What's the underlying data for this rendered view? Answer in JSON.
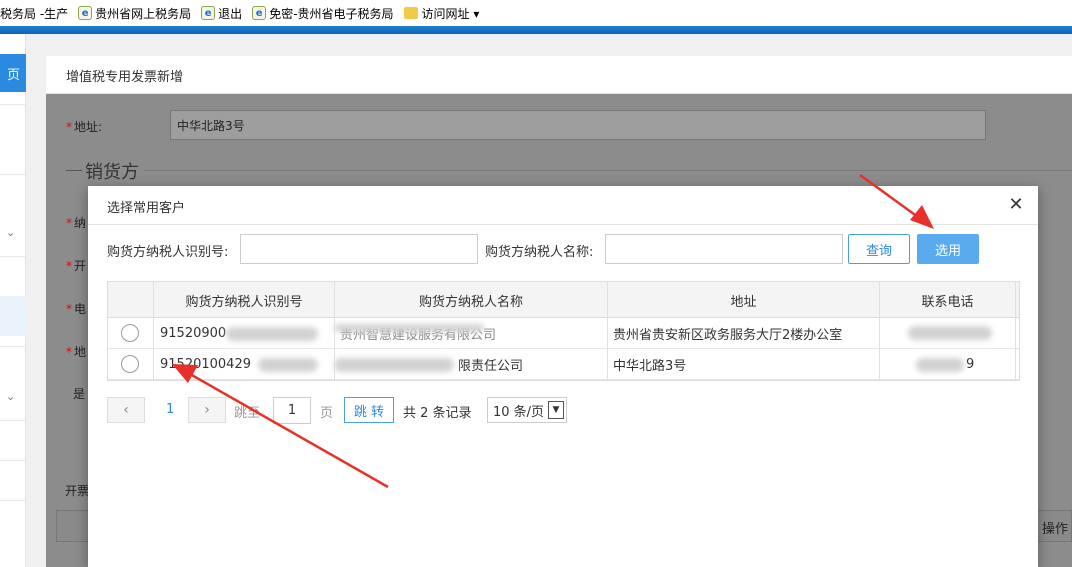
{
  "favorites": [
    {
      "label": "税务局 -生产",
      "icon": "none"
    },
    {
      "label": "贵州省网上税务局",
      "icon": "ie-icon"
    },
    {
      "label": "退出",
      "icon": "ie-icon"
    },
    {
      "label": "免密-贵州省电子税务局",
      "icon": "ie-icon"
    },
    {
      "label": "访问网址 ▾",
      "icon": "folder-icon"
    }
  ],
  "sidebar": {
    "home_label": "页"
  },
  "page": {
    "tab_title": "增值税专用发票新增",
    "address_label": "地址:",
    "address_value": "中华北路3号",
    "section_title": "销货方",
    "partial_labels": [
      "纳",
      "开",
      "电",
      "地"
    ],
    "partial_is": "是",
    "partial_kai": "开票",
    "operation_col": "操作"
  },
  "modal": {
    "title": "选择常用客户",
    "close_glyph": "✕",
    "search": {
      "taxid_label": "购货方纳税人识别号:",
      "taxid_value": "",
      "name_label": "购货方纳税人名称:",
      "name_value": ""
    },
    "buttons": {
      "query": "查询",
      "select": "选用"
    },
    "columns": [
      "购货方纳税人识别号",
      "购货方纳税人名称",
      "地址",
      "联系电话"
    ],
    "rows": [
      {
        "taxid": "91520900",
        "name": "贵州智慧建设服务有限公司",
        "address": "贵州省贵安新区政务服务大厅2楼办公室",
        "phone": ""
      },
      {
        "taxid": "91520100429",
        "name": "限责任公司",
        "address": "中华北路3号",
        "phone": "9"
      }
    ],
    "pager": {
      "prev": "‹",
      "next": "›",
      "current": "1",
      "goto_label": "跳至",
      "page_input": "1",
      "page_unit": "页",
      "jump_label": "跳 转",
      "total_text": "共 2 条记录",
      "page_size": "10 条/页"
    }
  },
  "colors": {
    "accent": "#2b8ae0",
    "primary_button": "#5aaaf0",
    "arrow": "#e8302a"
  }
}
